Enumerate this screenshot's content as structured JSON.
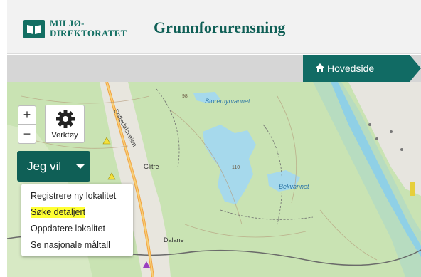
{
  "header": {
    "logo_line1": "MILJØ-",
    "logo_line2": "DIREKTORATET",
    "app_title": "Grunnforurensning"
  },
  "breadcrumb": {
    "home_label": "Hovedside"
  },
  "map": {
    "zoom_in": "+",
    "zoom_out": "−",
    "tools_label": "Verktøy",
    "labels": {
      "road": "Sofiedalsveien",
      "lake": "Storemyrvannet",
      "lake2": "Bekvannet",
      "place1": "Glitre",
      "place2": "Dalane",
      "elev1": "98",
      "elev2": "110"
    }
  },
  "jeg_vil": {
    "label": "Jeg vil",
    "menu": [
      {
        "label": "Registrere ny lokalitet",
        "highlighted": false
      },
      {
        "label": "Søke detaljert",
        "highlighted": true
      },
      {
        "label": "Oppdatere lokalitet",
        "highlighted": false
      },
      {
        "label": "Se nasjonale måltall",
        "highlighted": false
      }
    ]
  },
  "colors": {
    "brand": "#0f5f56",
    "map_green": "#c9e3b3",
    "water": "#a6d9ec",
    "highlight": "#ffff33"
  }
}
